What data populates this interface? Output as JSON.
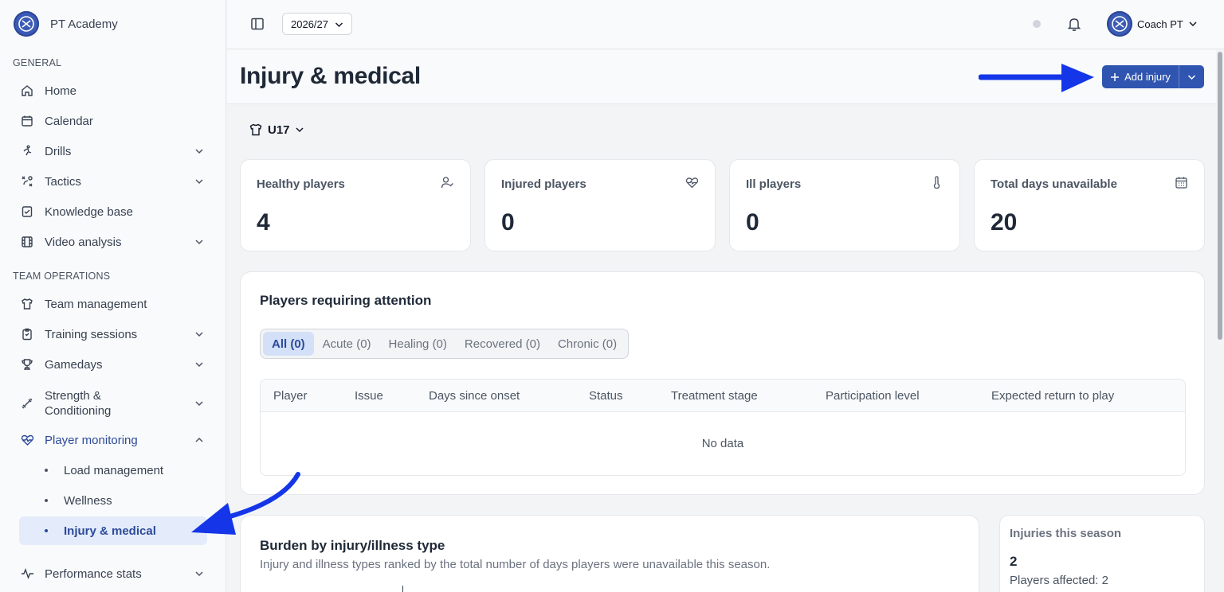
{
  "app": {
    "name": "PT Academy"
  },
  "sidebar": {
    "sections": [
      {
        "label": "GENERAL"
      },
      {
        "label": "TEAM OPERATIONS"
      }
    ],
    "items": [
      {
        "label": "Home",
        "icon": "home-icon"
      },
      {
        "label": "Calendar",
        "icon": "calendar-icon"
      },
      {
        "label": "Drills",
        "icon": "running-icon"
      },
      {
        "label": "Tactics",
        "icon": "tactics-icon"
      },
      {
        "label": "Knowledge base",
        "icon": "checklist-icon"
      },
      {
        "label": "Video analysis",
        "icon": "film-icon"
      },
      {
        "label": "Team management",
        "icon": "shirt-icon"
      },
      {
        "label": "Training sessions",
        "icon": "clipboard-icon"
      },
      {
        "label": "Gamedays",
        "icon": "trophy-icon"
      },
      {
        "label": "Strength & Conditioning",
        "icon": "dumbbell-icon"
      },
      {
        "label": "Player monitoring",
        "icon": "heart-pulse-icon"
      },
      {
        "label": "Performance stats",
        "icon": "activity-icon"
      }
    ],
    "subitems": [
      {
        "label": "Load management"
      },
      {
        "label": "Wellness"
      },
      {
        "label": "Injury & medical"
      }
    ]
  },
  "topbar": {
    "season": "2026/27",
    "user_name": "Coach PT"
  },
  "header": {
    "title": "Injury & medical",
    "add_label": "Add injury"
  },
  "team": {
    "label": "U17"
  },
  "stats": [
    {
      "label": "Healthy players",
      "value": "4",
      "icon": "user-check-icon"
    },
    {
      "label": "Injured players",
      "value": "0",
      "icon": "heart-pulse-icon"
    },
    {
      "label": "Ill players",
      "value": "0",
      "icon": "thermometer-icon"
    },
    {
      "label": "Total days unavailable",
      "value": "20",
      "icon": "calendar-icon"
    }
  ],
  "attention": {
    "title": "Players requiring attention",
    "tabs": [
      "All (0)",
      "Acute (0)",
      "Healing (0)",
      "Recovered (0)",
      "Chronic (0)"
    ],
    "columns": [
      "Player",
      "Issue",
      "Days since onset",
      "Status",
      "Treatment stage",
      "Participation level",
      "Expected return to play"
    ],
    "empty": "No data"
  },
  "burden": {
    "title": "Burden by injury/illness type",
    "subtitle": "Injury and illness types ranked by the total number of days players were unavailable this season."
  },
  "season_summary": {
    "label": "Injuries this season",
    "value": "2",
    "players_affected": "Players affected: 2"
  },
  "colors": {
    "accent": "#2f55b0",
    "active_bg": "#e4ecfb",
    "arrow": "#1436e8"
  }
}
